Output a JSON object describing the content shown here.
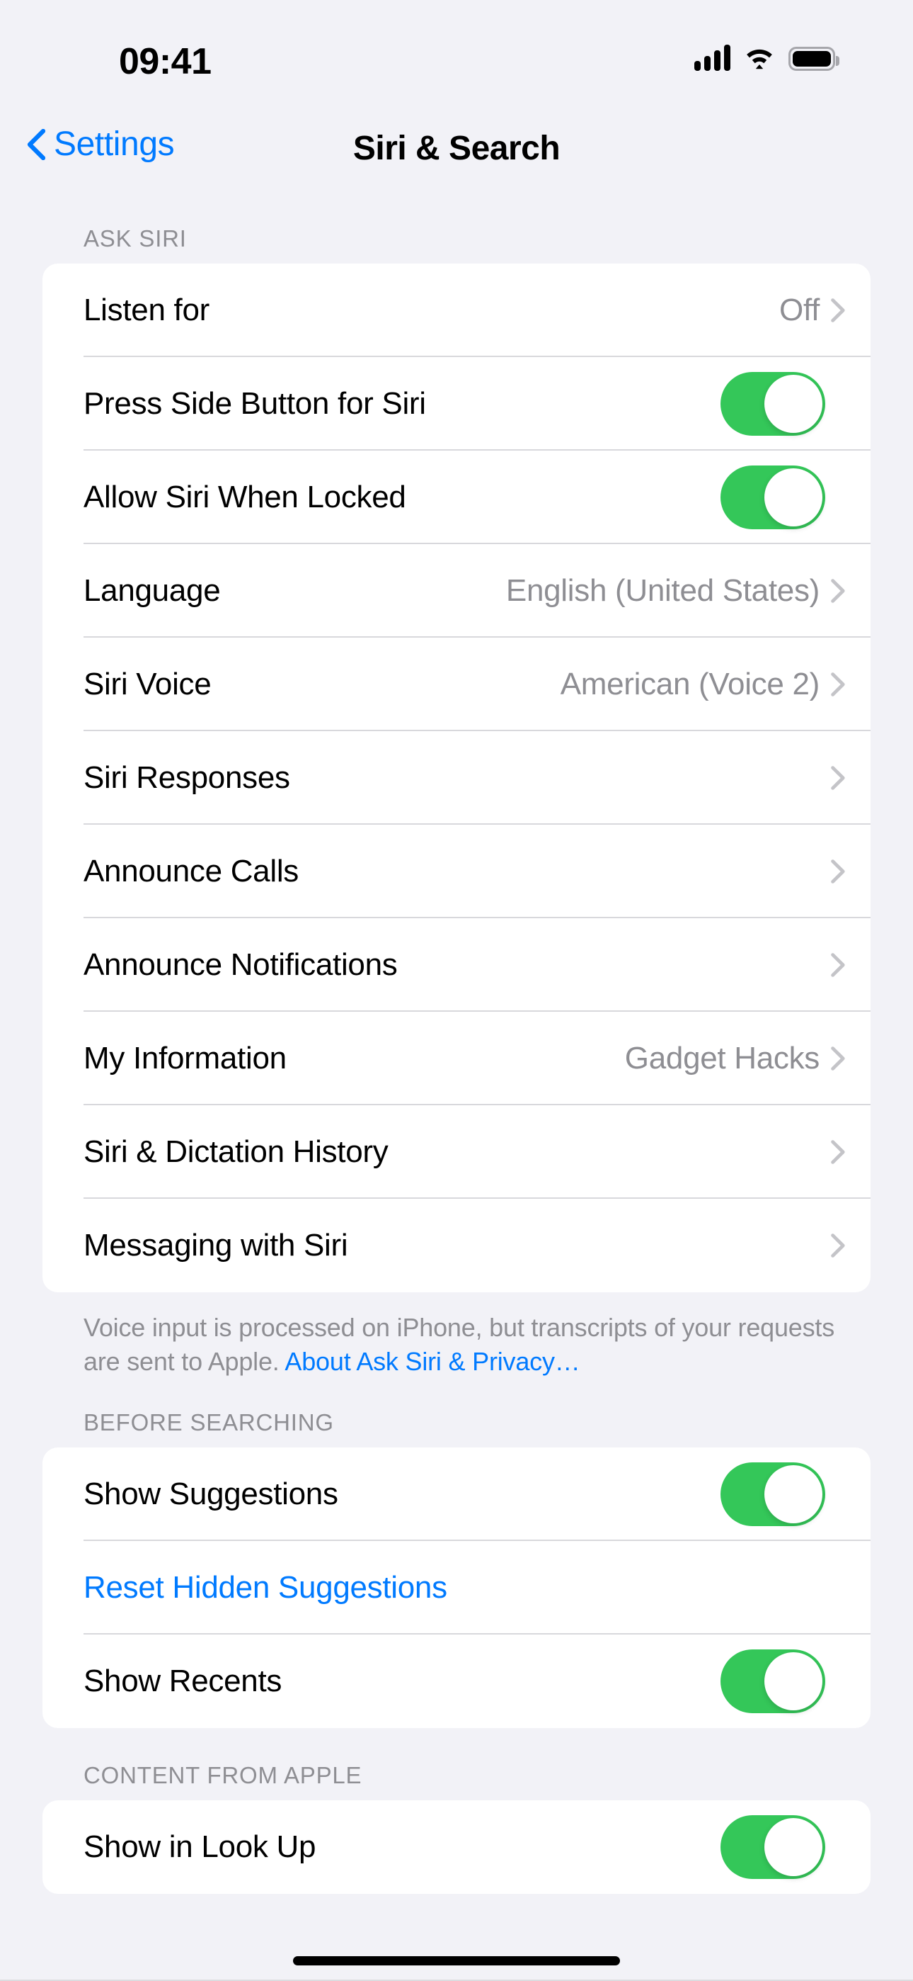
{
  "status_bar": {
    "time": "09:41",
    "cellular_icon": "cellular-signal-icon",
    "cellular_bars": 4,
    "wifi_icon": "wifi-icon",
    "battery_icon": "battery-full-icon",
    "battery_level": 100
  },
  "nav": {
    "back_label": "Settings",
    "back_icon": "chevron-left-icon",
    "title": "Siri & Search"
  },
  "colors": {
    "background": "#F2F2F7",
    "card": "#FFFFFF",
    "accent_blue": "#007AFF",
    "toggle_on_green": "#34C759",
    "secondary_text": "#8E8E93",
    "separator": "#D8D8DC"
  },
  "sections": [
    {
      "header": "ASK SIRI",
      "rows": [
        {
          "label": "Listen for",
          "type": "value",
          "value": "Off",
          "chevron": true
        },
        {
          "label": "Press Side Button for Siri",
          "type": "toggle",
          "on": true
        },
        {
          "label": "Allow Siri When Locked",
          "type": "toggle",
          "on": true
        },
        {
          "label": "Language",
          "type": "value",
          "value": "English (United States)",
          "chevron": true
        },
        {
          "label": "Siri Voice",
          "type": "value",
          "value": "American (Voice 2)",
          "chevron": true
        },
        {
          "label": "Siri Responses",
          "type": "value",
          "value": "",
          "chevron": true
        },
        {
          "label": "Announce Calls",
          "type": "value",
          "value": "",
          "chevron": true
        },
        {
          "label": "Announce Notifications",
          "type": "value",
          "value": "",
          "chevron": true
        },
        {
          "label": "My Information",
          "type": "value",
          "value": "Gadget Hacks",
          "chevron": true
        },
        {
          "label": "Siri & Dictation History",
          "type": "value",
          "value": "",
          "chevron": true
        },
        {
          "label": "Messaging with Siri",
          "type": "value",
          "value": "",
          "chevron": true
        }
      ],
      "footer_text": "Voice input is processed on iPhone, but transcripts of your requests are sent to Apple. ",
      "footer_link": "About Ask Siri & Privacy…"
    },
    {
      "header": "BEFORE SEARCHING",
      "rows": [
        {
          "label": "Show Suggestions",
          "type": "toggle",
          "on": true
        },
        {
          "label": "Reset Hidden Suggestions",
          "type": "action"
        },
        {
          "label": "Show Recents",
          "type": "toggle",
          "on": true
        }
      ]
    },
    {
      "header": "CONTENT FROM APPLE",
      "rows": [
        {
          "label": "Show in Look Up",
          "type": "toggle",
          "on": true
        }
      ]
    }
  ]
}
